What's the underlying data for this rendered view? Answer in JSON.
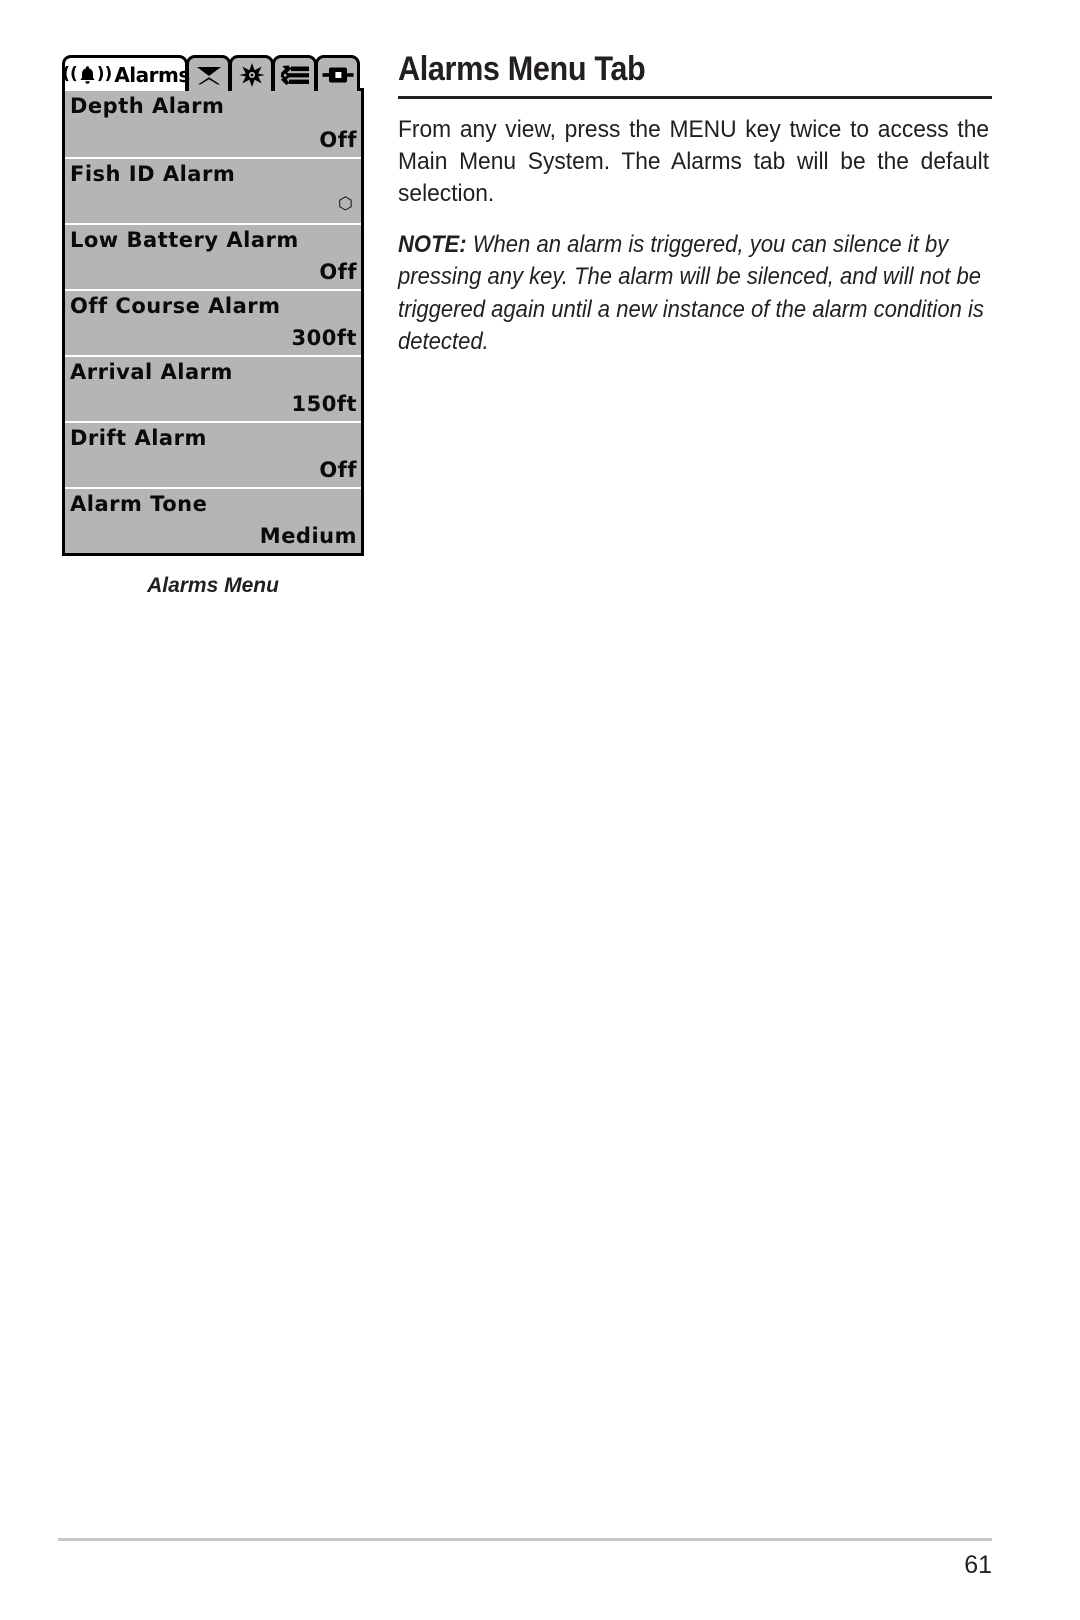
{
  "page": {
    "number": "61"
  },
  "figure": {
    "caption": "Alarms Menu",
    "colors": {
      "lcd_background": "#b5b5b5",
      "lcd_border": "#000000",
      "active_tab_background": "#ffffff",
      "separator": "#ffffff"
    },
    "tabs": [
      {
        "id": "alarms",
        "label": "Alarms",
        "icon": "bell-icon",
        "active": true
      },
      {
        "id": "sonar",
        "label": "",
        "icon": "sonar-cone-icon",
        "active": false
      },
      {
        "id": "display",
        "label": "",
        "icon": "brightness-sun-icon",
        "active": false
      },
      {
        "id": "setup",
        "label": "",
        "icon": "wrench-sliders-icon",
        "active": false
      },
      {
        "id": "accessories",
        "label": "",
        "icon": "accessory-connector-icon",
        "active": false
      }
    ],
    "menu_rows": [
      {
        "label": "Depth Alarm",
        "value": "Off",
        "value_type": "text"
      },
      {
        "label": "Fish ID Alarm",
        "value": "⬡",
        "value_type": "glyph"
      },
      {
        "label": "Low Battery Alarm",
        "value": "Off",
        "value_type": "text"
      },
      {
        "label": "Off Course Alarm",
        "value": "300ft",
        "value_type": "text"
      },
      {
        "label": "Arrival Alarm",
        "value": "150ft",
        "value_type": "text"
      },
      {
        "label": "Drift Alarm",
        "value": "Off",
        "value_type": "text"
      },
      {
        "label": "Alarm Tone",
        "value": "Medium",
        "value_type": "text"
      }
    ]
  },
  "content": {
    "heading": "Alarms Menu Tab",
    "paragraph": "From any view, press the MENU key twice to access the Main Menu System. The Alarms tab will be the default selection.",
    "note": {
      "label": "NOTE:",
      "text": " When an alarm is triggered, you can silence it by pressing any key.  The alarm will be silenced, and will not be triggered again until a new instance of the alarm condition is detected."
    }
  }
}
